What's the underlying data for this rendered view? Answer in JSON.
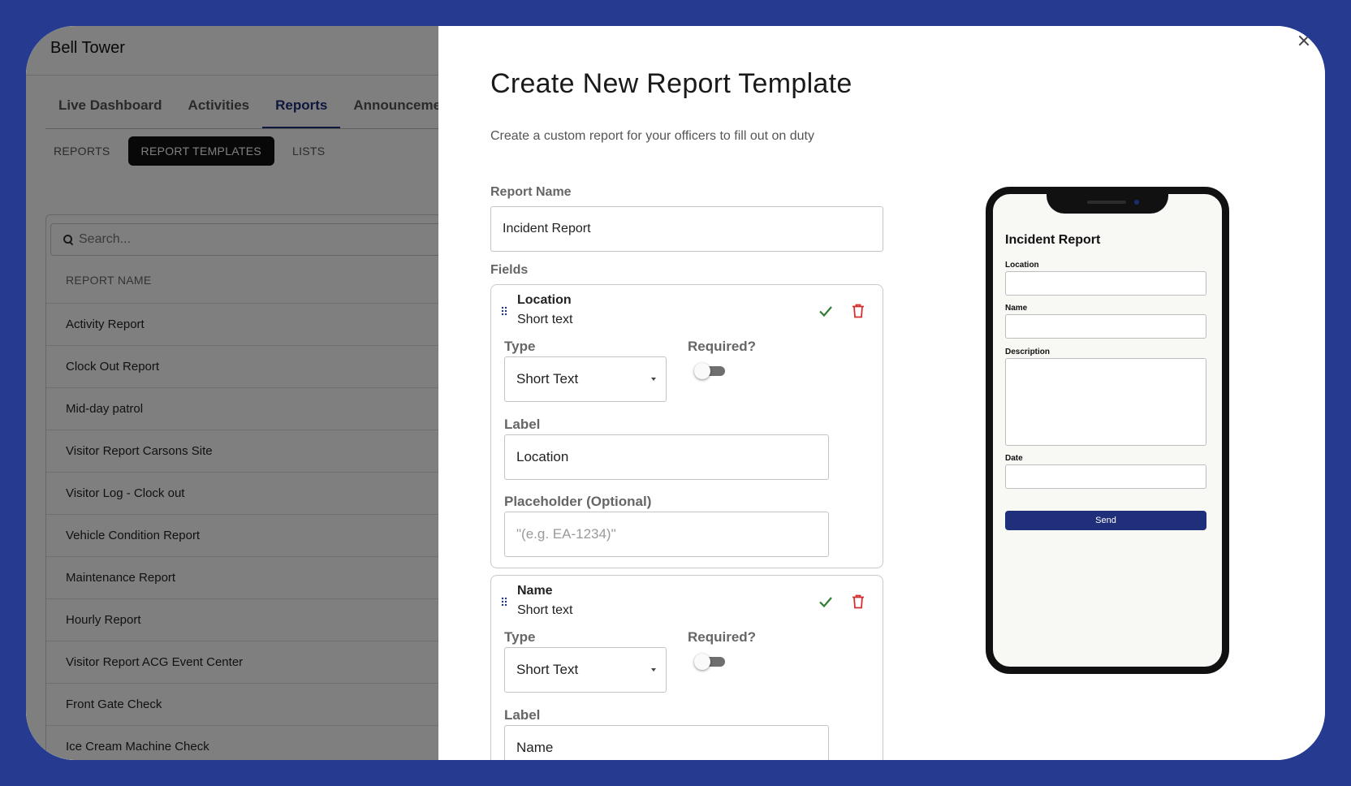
{
  "app": {
    "org_name": "Bell Tower",
    "main_tabs": [
      {
        "label": "Live Dashboard"
      },
      {
        "label": "Activities"
      },
      {
        "label": "Reports"
      },
      {
        "label": "Announcement"
      }
    ],
    "sub_tabs": [
      {
        "label": "REPORTS"
      },
      {
        "label": "REPORT TEMPLATES"
      },
      {
        "label": "LISTS"
      }
    ],
    "search": {
      "placeholder": "Search..."
    },
    "table": {
      "column_header": "REPORT NAME",
      "rows": [
        "Activity Report",
        "Clock Out Report",
        "Mid-day patrol",
        "Visitor Report Carsons Site",
        "Visitor Log - Clock out",
        "Vehicle Condition Report",
        "Maintenance Report",
        "Hourly Report",
        "Visitor Report ACG Event Center",
        "Front Gate Check",
        "Ice Cream Machine Check"
      ]
    }
  },
  "modal": {
    "title": "Create New Report Template",
    "subtitle": "Create a custom report for your officers to fill out on duty",
    "report_name_label": "Report Name",
    "report_name_value": "Incident Report",
    "fields_label": "Fields",
    "fields": [
      {
        "name": "Location",
        "type_display": "Short text",
        "type_label": "Type",
        "type_value": "Short Text",
        "required_label": "Required?",
        "label_label": "Label",
        "label_value": "Location",
        "placeholder_label": "Placeholder (Optional)",
        "placeholder_hint": "\"(e.g. EA-1234)\""
      },
      {
        "name": "Name",
        "type_display": "Short text",
        "type_label": "Type",
        "type_value": "Short Text",
        "required_label": "Required?",
        "label_label": "Label",
        "label_value": "Name"
      }
    ]
  },
  "preview": {
    "title": "Incident Report",
    "fields": [
      "Location",
      "Name",
      "Description",
      "Date"
    ],
    "button_label": "Send"
  },
  "colors": {
    "brand": "#1f2f7a",
    "frame": "#263a8f",
    "confirm": "#2e7d32",
    "delete": "#d32f2f"
  }
}
